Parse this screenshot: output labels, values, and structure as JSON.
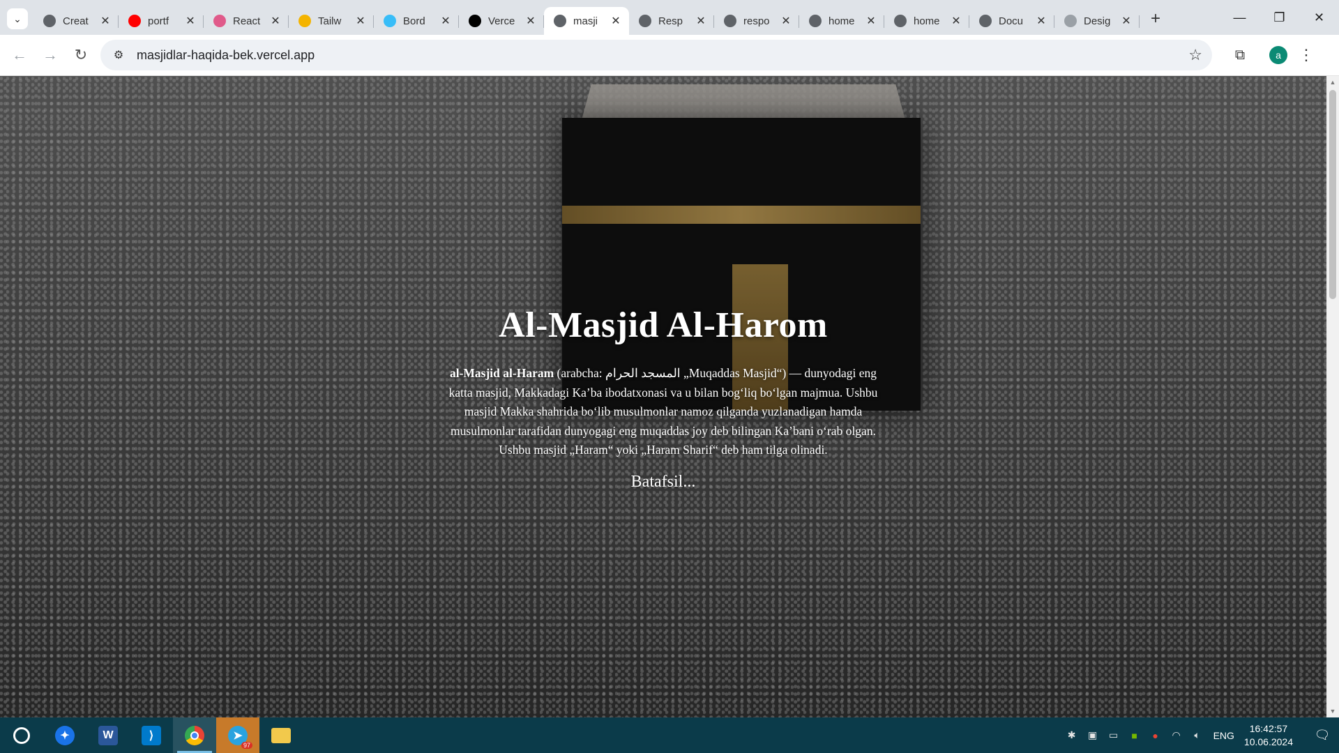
{
  "browser": {
    "tabs": [
      {
        "label": "Creat",
        "icon": "globe-icon",
        "color": "#5f6368"
      },
      {
        "label": "portf",
        "icon": "youtube-icon",
        "color": "#ff0000"
      },
      {
        "label": "React",
        "icon": "react-icon",
        "color": "#e05a8a"
      },
      {
        "label": "Tailw",
        "icon": "person-icon",
        "color": "#f4b400"
      },
      {
        "label": "Bord",
        "icon": "tailwind-icon",
        "color": "#38bdf8"
      },
      {
        "label": "Verce",
        "icon": "vercel-icon",
        "color": "#000000"
      },
      {
        "label": "masji",
        "icon": "globe-icon",
        "color": "#5f6368",
        "active": true
      },
      {
        "label": "Resp",
        "icon": "globe-icon",
        "color": "#5f6368"
      },
      {
        "label": "respo",
        "icon": "globe-icon",
        "color": "#5f6368"
      },
      {
        "label": "home",
        "icon": "globe-icon",
        "color": "#5f6368"
      },
      {
        "label": "home",
        "icon": "globe-icon",
        "color": "#5f6368"
      },
      {
        "label": "Docu",
        "icon": "globe-icon",
        "color": "#5f6368"
      },
      {
        "label": "Desig",
        "icon": "loading-icon",
        "color": "#9aa0a6"
      }
    ],
    "url": "masjidlar-haqida-bek.vercel.app",
    "profile_initial": "a"
  },
  "page": {
    "title": "Al-Masjid Al-Harom",
    "intro_bold": "al-Masjid al-Haram",
    "intro_rest": " (arabcha: المسجد الحرام „Muqaddas Masjid“) — dunyodagi eng katta masjid, Makkadagi Ka’ba ibodatxonasi va u bilan bog‘liq bo‘lgan majmua. Ushbu masjid Makka shahrida bo‘lib musulmonlar namoz qilganda yuzlanadigan hamda musulmonlar tarafidan dunyogagi eng muqaddas joy deb bilingan Ka’bani o‘rab olgan. Ushbu masjid „Haram“ yoki „Haram Sharif“ deb ham tilga olinadi.",
    "more_link": "Batafsil..."
  },
  "taskbar": {
    "apps": [
      "cortana-icon",
      "pin-app-icon",
      "word-icon",
      "vscode-icon",
      "chrome-icon",
      "telegram-icon",
      "file-explorer-icon"
    ],
    "telegram_badge": "97",
    "language": "ENG",
    "time": "16:42:57",
    "date": "10.06.2024"
  },
  "colors": {
    "taskbar": "#0b3b4a",
    "tabstrip": "#dfe3e8",
    "avatar": "#0b8a74"
  }
}
